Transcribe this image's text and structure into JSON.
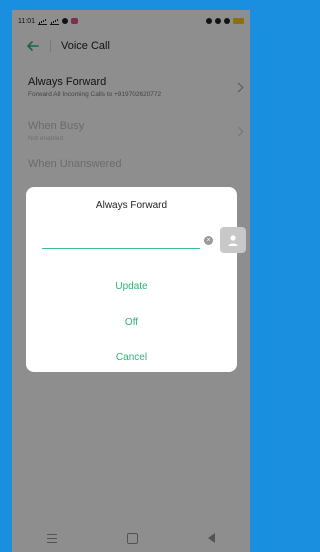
{
  "status_bar": {
    "time": "11:01"
  },
  "app_bar": {
    "title": "Voice Call"
  },
  "settings": [
    {
      "title": "Always Forward",
      "subtitle": "Forward All Incoming Calls to +919702620772"
    },
    {
      "title": "When Busy",
      "subtitle": "Not enabled"
    },
    {
      "title": "When Unanswered",
      "subtitle": ""
    }
  ],
  "dialog": {
    "title": "Always Forward",
    "phone_value": "",
    "phone_placeholder": "",
    "update_label": "Update",
    "off_label": "Off",
    "cancel_label": "Cancel"
  },
  "colors": {
    "accent": "#2eb374",
    "background": "#1a8fe0"
  },
  "icons": {
    "back": "back-arrow-icon",
    "clear": "clear-circle-icon",
    "contact": "contact-person-icon"
  }
}
